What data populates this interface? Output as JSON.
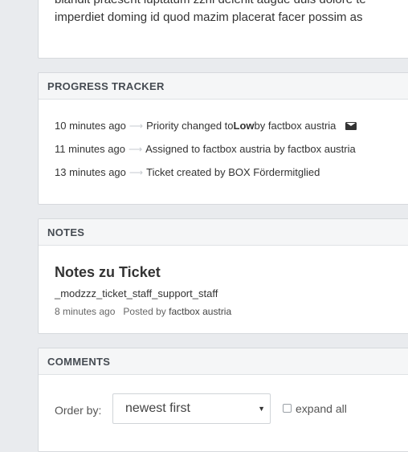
{
  "top_text": {
    "line1": "blandit praesent luptatum zzril delenit augue duis dolore te",
    "line2": "imperdiet doming id quod mazim placerat facer possim as"
  },
  "progress_tracker": {
    "heading": "PROGRESS TRACKER",
    "arrow": "⟶",
    "events": [
      {
        "time": "10 minutes ago",
        "text_before": "Priority changed to ",
        "emphasis": "Low",
        "text_after": " by factbox austria",
        "icon": "envelope-icon"
      },
      {
        "time": "11 minutes ago",
        "text_before": "Assigned to factbox austria by factbox austria"
      },
      {
        "time": "13 minutes ago",
        "text_before": "Ticket created by BOX Fördermitglied"
      }
    ]
  },
  "notes": {
    "heading": "NOTES",
    "title": "Notes zu Ticket",
    "body": "_modzzz_ticket_staff_support_staff",
    "time": "8 minutes ago",
    "posted_by_label": "Posted by",
    "author": "factbox austria"
  },
  "comments": {
    "heading": "COMMENTS",
    "order_label": "Order by:",
    "order_value": "newest first",
    "expand_label": "expand all",
    "expand_checked": false
  }
}
